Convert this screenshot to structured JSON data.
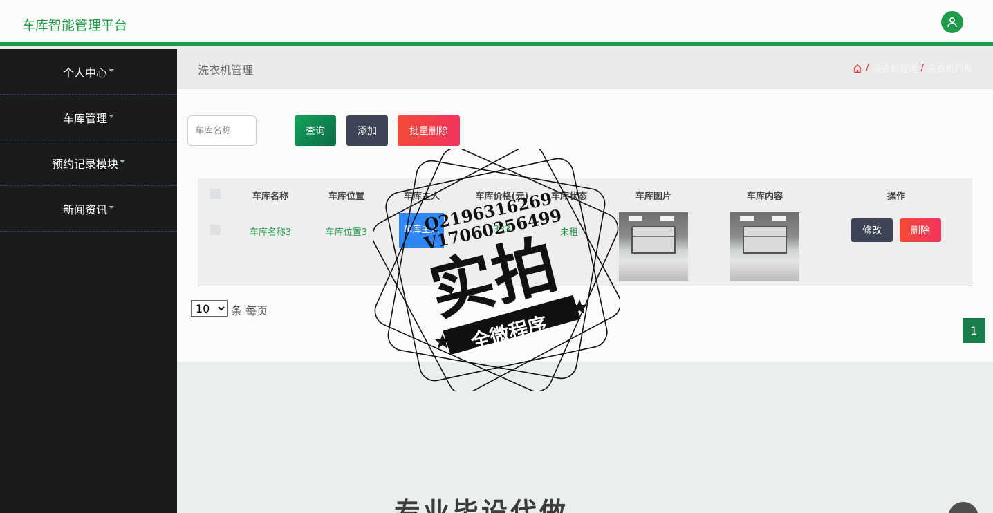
{
  "app": {
    "title": "车库智能管理平台"
  },
  "sidebar": {
    "items": [
      {
        "label": "个人中心"
      },
      {
        "label": "车库管理"
      },
      {
        "label": "预约记录模块"
      },
      {
        "label": "新闻资讯"
      }
    ]
  },
  "page": {
    "title": "洗衣机管理",
    "breadcrumb": [
      "洗衣机管理",
      "洗衣机列表"
    ],
    "breadcrumb_separator": "/"
  },
  "toolbar": {
    "search_placeholder": "车库名称",
    "query_label": "查询",
    "add_label": "添加",
    "batch_delete_label": "批量删除"
  },
  "table": {
    "columns": [
      "车库名称",
      "车库位置",
      "车库主人",
      "车库价格(元)",
      "车库状态",
      "车库图片",
      "车库内容",
      "操作"
    ],
    "rows": [
      {
        "name": "车库名称3",
        "location": "车库位置3",
        "owner": "车库主人",
        "price": "333",
        "status": "未租",
        "edit_label": "修改",
        "delete_label": "删除"
      }
    ]
  },
  "pagination": {
    "page_size": "10",
    "page_size_options": [
      "10"
    ],
    "per_page_label": "条 每页",
    "current_page": "1"
  },
  "watermark": {
    "line1": "Q2196316269",
    "line2": "V17060256499",
    "main": "实拍",
    "banner": "全微程序"
  },
  "footer_banner": {
    "text": "专业毕设代做"
  },
  "colors": {
    "brand": "#1f9a4a",
    "sidebar_bg": "#1a1b1b",
    "danger": "#f2345d",
    "dark_button": "#3c4456"
  }
}
